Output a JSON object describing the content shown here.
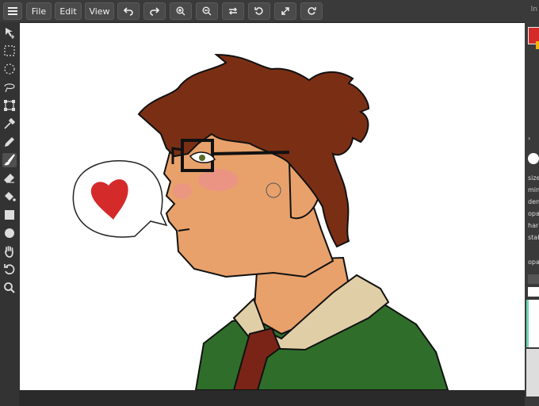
{
  "menu": {
    "file_label": "File",
    "edit_label": "Edit",
    "view_label": "View"
  },
  "right_panel": {
    "top_label": "In",
    "primary_color": "#d42a2a",
    "secondary_color": "#f0b400",
    "brush_params": [
      "size",
      "min",
      "den",
      "opa",
      "har",
      "stab"
    ],
    "layers_label": "opa"
  },
  "tools": [
    "move",
    "rect-select",
    "ellipse-select",
    "lasso",
    "transform",
    "eyedropper",
    "pencil",
    "brush",
    "eraser",
    "fill",
    "rectangle",
    "ellipse",
    "hand",
    "undo-rotate",
    "zoom"
  ],
  "canvas": {
    "speech_bubble_icon": "heart-icon"
  }
}
